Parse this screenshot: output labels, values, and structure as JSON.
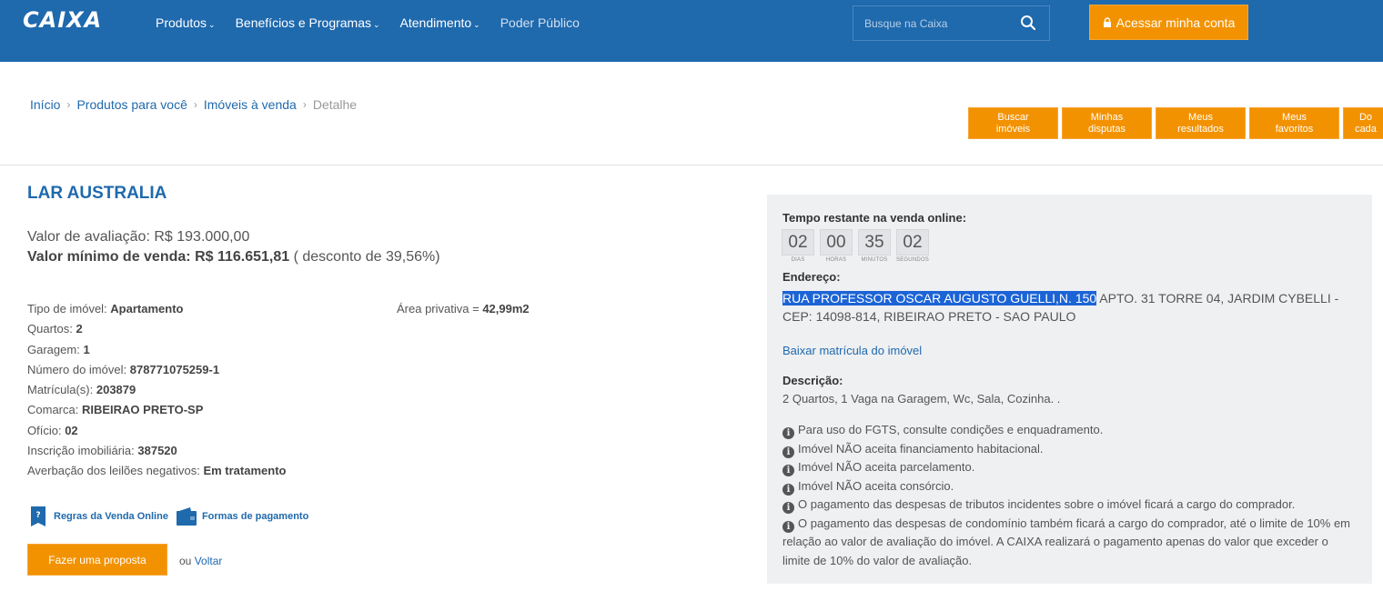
{
  "header": {
    "logo": "CAIXA",
    "nav": [
      {
        "label": "Produtos",
        "caret": "⌄"
      },
      {
        "label": "Benefícios e Programas",
        "caret": "⌄"
      },
      {
        "label": "Atendimento",
        "caret": "⌄"
      },
      {
        "label": "Poder Público",
        "caret": ""
      }
    ],
    "search_placeholder": "Busque na Caixa",
    "login_label": "Acessar minha conta"
  },
  "breadcrumb": {
    "items": [
      "Início",
      "Produtos para você",
      "Imóveis à venda"
    ],
    "current": "Detalhe",
    "separator": "›"
  },
  "tabs": [
    {
      "line1": "Buscar",
      "line2": "imóveis"
    },
    {
      "line1": "Minhas",
      "line2": "disputas"
    },
    {
      "line1": "Meus",
      "line2": "resultados"
    },
    {
      "line1": "Meus",
      "line2": "favoritos"
    },
    {
      "line1": "Do",
      "line2": "cada"
    }
  ],
  "property": {
    "title": "LAR AUSTRALIA",
    "valor_avaliacao_label": "Valor de avaliação:",
    "valor_avaliacao": "R$ 193.000,00",
    "valor_minimo_label": "Valor mínimo de venda:",
    "valor_minimo": "R$ 116.651,81",
    "desconto": "( desconto de 39,56%)",
    "details": [
      {
        "label": "Tipo de imóvel:",
        "value": "Apartamento"
      },
      {
        "label": "Quartos:",
        "value": "2"
      },
      {
        "label": "Garagem:",
        "value": "1"
      },
      {
        "label": "Número do imóvel:",
        "value": "878771075259-1"
      },
      {
        "label": "Matrícula(s):",
        "value": "203879"
      },
      {
        "label": "Comarca:",
        "value": "RIBEIRAO PRETO-SP"
      },
      {
        "label": "Ofício:",
        "value": "02"
      },
      {
        "label": "Inscrição imobiliária:",
        "value": "387520"
      },
      {
        "label": "Averbação dos leilões negativos:",
        "value": "Em tratamento"
      }
    ],
    "area_label": "Área privativa =",
    "area_value": "42,99m2",
    "regras_link": "Regras da Venda Online",
    "pagamento_link": "Formas de pagamento",
    "proposal_button": "Fazer uma proposta",
    "voltar_prefix": "ou",
    "voltar_link": "Voltar"
  },
  "panel": {
    "tempo_label": "Tempo restante na venda online:",
    "timer": [
      {
        "value": "02",
        "unit": "DIAS"
      },
      {
        "value": "00",
        "unit": "HORAS"
      },
      {
        "value": "35",
        "unit": "MINUTOS"
      },
      {
        "value": "02",
        "unit": "SEGUNDOS"
      }
    ],
    "endereco_label": "Endereço:",
    "endereco_highlight": "RUA PROFESSOR OSCAR AUGUSTO GUELLI,N. 150",
    "endereco_rest": " APTO. 31 TORRE 04, JARDIM CYBELLI - CEP: 14098-814, RIBEIRAO PRETO - SAO PAULO",
    "matricula_link": "Baixar matrícula do imóvel",
    "descricao_label": "Descrição:",
    "descricao": "2 Quartos, 1 Vaga na Garagem, Wc, Sala, Cozinha. .",
    "info": [
      "Para uso do FGTS, consulte condições e enquadramento.",
      "Imóvel NÃO aceita financiamento habitacional.",
      "Imóvel NÃO aceita parcelamento.",
      "Imóvel NÃO aceita consórcio.",
      "O pagamento das despesas de tributos incidentes sobre o imóvel ficará a cargo do comprador.",
      "O pagamento das despesas de condomínio também ficará a cargo do comprador, até o limite de 10% em relação ao valor de avaliação do imóvel. A CAIXA realizará o pagamento apenas do valor que exceder o limite de 10% do valor de avaliação."
    ]
  },
  "colors": {
    "brand_blue": "#1f69ad",
    "accent_orange": "#f39200",
    "panel_bg": "#eff0f2",
    "highlight": "#1c64d6"
  },
  "icons": {
    "search": "search-icon",
    "lock": "lock-icon",
    "doc": "rules-document-icon",
    "wallet": "wallet-icon",
    "info": "info-icon"
  }
}
